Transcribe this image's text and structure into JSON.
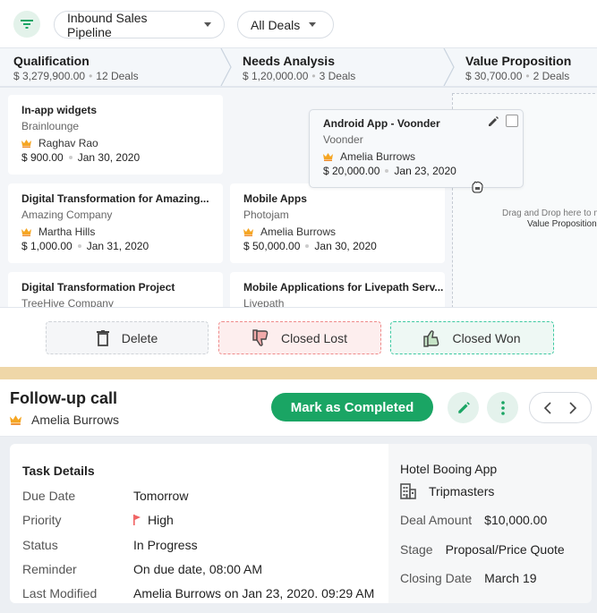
{
  "toolbar": {
    "filter_icon": "filter-icon",
    "pipeline_select": "Inbound Sales Pipeline",
    "deals_select": "All Deals"
  },
  "stages": [
    {
      "title": "Qualification",
      "amount": "$ 3,279,900.00",
      "count": "12 Deals"
    },
    {
      "title": "Needs Analysis",
      "amount": "$ 1,20,000.00",
      "count": "3 Deals"
    },
    {
      "title": "Value Proposition",
      "amount": "$ 30,700.00",
      "count": "2 Deals"
    }
  ],
  "columns": [
    {
      "cards": [
        {
          "title": "In-app widgets",
          "company": "Brainlounge",
          "owner": "Raghav Rao",
          "amount": "$ 900.00",
          "date": "Jan 30, 2020"
        },
        {
          "title": "Digital Transformation for Amazing...",
          "company": "Amazing Company",
          "owner": "Martha Hills",
          "amount": "$ 1,000.00",
          "date": "Jan 31, 2020"
        },
        {
          "title": "Digital Transformation Project",
          "company": "TreeHive Company",
          "owner": "",
          "amount": "",
          "date": ""
        }
      ]
    },
    {
      "cards": [
        {
          "title": "Mobile Apps",
          "company": "Photojam",
          "owner": "Amelia Burrows",
          "amount": "$ 50,000.00",
          "date": "Jan 30, 2020"
        },
        {
          "title": "Mobile Applications for Livepath Serv...",
          "company": "Livepath",
          "owner": "",
          "amount": "",
          "date": ""
        }
      ]
    }
  ],
  "dragging_card": {
    "title": "Android App - Voonder",
    "company": "Voonder",
    "owner": "Amelia Burrows",
    "amount": "$ 20,000.00",
    "date": "Jan 23, 2020"
  },
  "dropzone": {
    "text": "Drag and Drop here to m",
    "stage": "Value Proposition"
  },
  "actions": {
    "delete": "Delete",
    "closed_lost": "Closed Lost",
    "closed_won": "Closed Won"
  },
  "task": {
    "title": "Follow-up call",
    "owner": "Amelia Burrows",
    "complete_label": "Mark as Completed",
    "details_heading": "Task Details",
    "rows": [
      {
        "label": "Due Date",
        "value": "Tomorrow"
      },
      {
        "label": "Priority",
        "value": "High"
      },
      {
        "label": "Status",
        "value": "In Progress"
      },
      {
        "label": "Reminder",
        "value": "On due date, 08:00 AM"
      },
      {
        "label": "Last Modified",
        "value": "Amelia Burrows on Jan 23, 2020. 09:29 AM"
      }
    ]
  },
  "deal": {
    "name": "Hotel Booing App",
    "company": "Tripmasters",
    "rows": [
      {
        "label": "Deal Amount",
        "value": "$10,000.00"
      },
      {
        "label": "Stage",
        "value": "Proposal/Price Quote"
      },
      {
        "label": "Closing Date",
        "value": "March 19"
      }
    ]
  },
  "colors": {
    "accent_green": "#1aa564",
    "priority_flag": "#f06262",
    "crown": "#f5a623",
    "tan_strip": "#efd7a8"
  }
}
